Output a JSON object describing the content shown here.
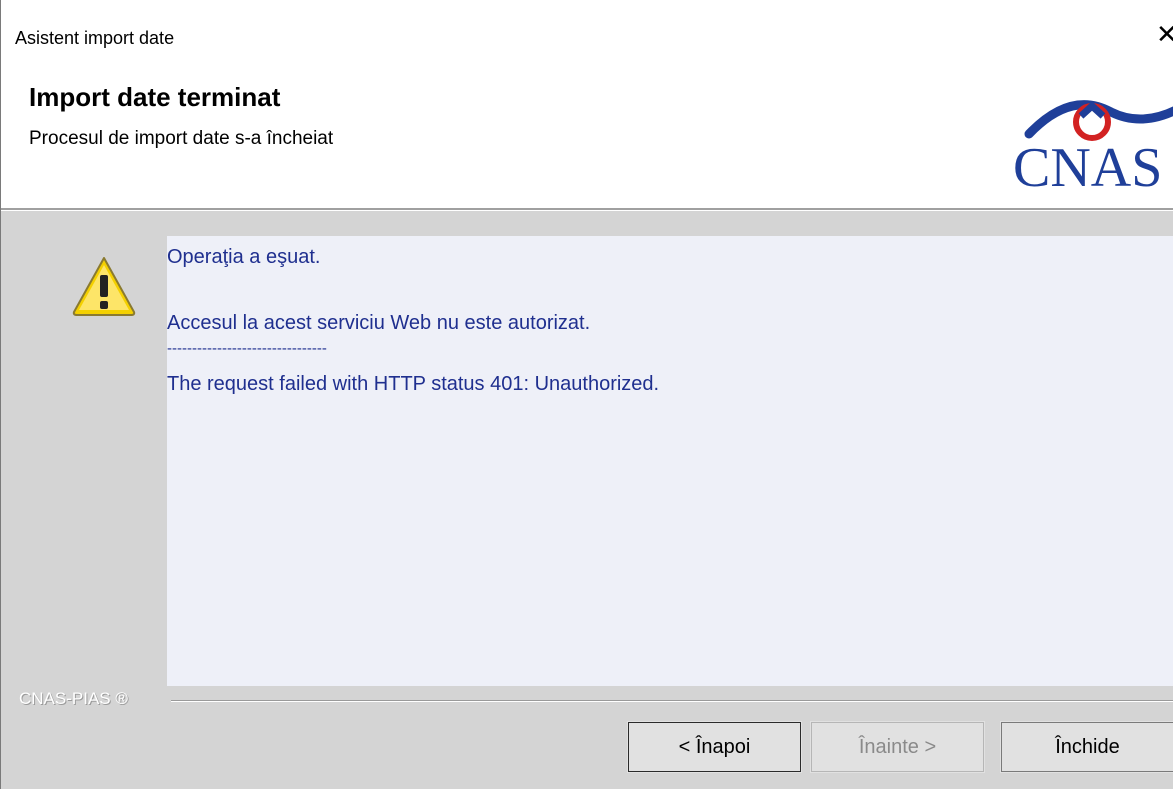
{
  "window": {
    "title": "Asistent import date",
    "close_glyph": "✕"
  },
  "header": {
    "title": "Import date terminat",
    "subtitle": "Procesul de import date s-a încheiat",
    "logo_text": "CNAS",
    "logo_colors": {
      "text": "#1f3f99",
      "arc": "#1f3f99",
      "circle": "#d22222"
    }
  },
  "body": {
    "icon": "warning-icon",
    "messages": {
      "line1": "Operaţia a eşuat.",
      "line2": "Accesul la acest serviciu Web nu este autorizat.",
      "line3": "--------------------------------",
      "line4": "The request failed with HTTP status 401: Unauthorized."
    },
    "message_color": "#1f2f8f"
  },
  "footer": {
    "brand_label": "CNAS-PIAS ®",
    "buttons": {
      "back": "< Înapoi",
      "next": "Înainte >",
      "close": "Închide"
    }
  }
}
